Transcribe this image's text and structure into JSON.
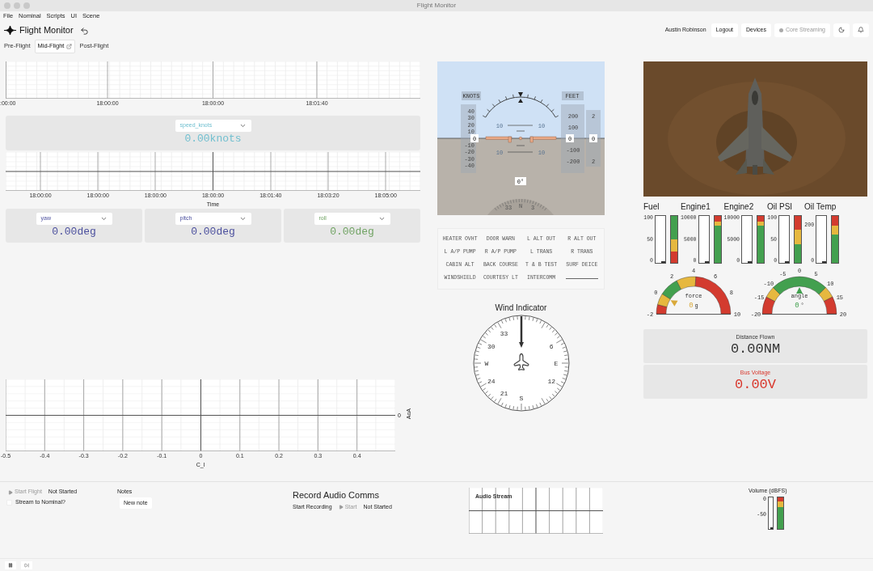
{
  "window": {
    "title": "Flight Monitor"
  },
  "menu": [
    "File",
    "Nominal",
    "Scripts",
    "UI",
    "Scene"
  ],
  "app": {
    "title": "Flight Monitor"
  },
  "user": {
    "name": "Austin Robinson"
  },
  "header_buttons": [
    {
      "label": "Logout"
    },
    {
      "label": "Devices"
    }
  ],
  "streaming": {
    "label": "Core Streaming",
    "disabled": true
  },
  "tabs": [
    {
      "label": "Pre-Flight",
      "selected": false,
      "popout": false
    },
    {
      "label": "Mid-Flight",
      "selected": true,
      "popout": true
    },
    {
      "label": "Post-Flight",
      "selected": false,
      "popout": false
    }
  ],
  "time_chart_top": {
    "x_tick_labels": [
      ":00:00",
      "18:00:00",
      "18:00:00",
      "18:01:40"
    ]
  },
  "speed_readout": {
    "channel": "speed_knots",
    "value": "0.00knots",
    "color": "#72c0d0"
  },
  "time_chart": {
    "x_tick_labels": [
      "18:00:00",
      "18:00:00",
      "18:00:00",
      "18:00:00",
      "18:01:40",
      "18:03:20",
      "18:05:00"
    ],
    "xlabel": "Time"
  },
  "readouts": [
    {
      "channel": "yaw",
      "value": "0.00deg",
      "color": "#4c509e"
    },
    {
      "channel": "pitch",
      "value": "0.00deg",
      "color": "#4c509e"
    },
    {
      "channel": "roll",
      "value": "0.00deg",
      "color": "#72a465"
    }
  ],
  "aoa_chart": {
    "x_tick_labels": [
      "-0.5",
      "-0.4",
      "-0.3",
      "-0.2",
      "-0.1",
      "0",
      "0.1",
      "0.2",
      "0.3",
      "0.4"
    ],
    "y_tick_labels": [
      "0"
    ],
    "xlabel": "C_l",
    "ylabel": "AoA"
  },
  "attitude": {
    "speed_title": "KNOTS",
    "speed_labels": [
      "40",
      "30",
      "20",
      "10",
      "-10",
      "-20",
      "-30",
      "-40"
    ],
    "speed_value": "0",
    "alt_title": "FEET",
    "alt_labels": [
      "200",
      "100",
      "-100",
      "-200"
    ],
    "alt_value": "0",
    "vs_labels": [
      "2",
      "2"
    ],
    "vs_value": "0",
    "pitch_labels": [
      "10",
      "10",
      "10",
      "10"
    ],
    "heading": "0°",
    "compass_labels": [
      "33",
      "N",
      "3"
    ]
  },
  "annunciators": [
    {
      "kind": "label",
      "text": "HEATER OVHT"
    },
    {
      "kind": "label",
      "text": "DOOR WARN"
    },
    {
      "kind": "label",
      "text": "L ALT OUT"
    },
    {
      "kind": "label",
      "text": "R ALT OUT"
    },
    {
      "kind": "label",
      "text": "L A/P PUMP"
    },
    {
      "kind": "label",
      "text": "R A/P PUMP"
    },
    {
      "kind": "label",
      "text": "L TRANS"
    },
    {
      "kind": "label",
      "text": "R TRANS"
    },
    {
      "kind": "label",
      "text": "CABIN ALT"
    },
    {
      "kind": "label",
      "text": "BACK COURSE"
    },
    {
      "kind": "label",
      "text": "T & B TEST"
    },
    {
      "kind": "label",
      "text": "SURF DEICE"
    },
    {
      "kind": "label",
      "text": "WINDSHIELD"
    },
    {
      "kind": "label",
      "text": "COURTESY LT"
    },
    {
      "kind": "label",
      "text": "INTERCOMM"
    },
    {
      "kind": "blank"
    }
  ],
  "wind": {
    "title": "Wind Indicator",
    "labels": [
      "33",
      "30",
      "W",
      "24",
      "21",
      "S",
      "12",
      "E",
      "6"
    ]
  },
  "bar_gauges": [
    {
      "label": "Fuel",
      "ticks": [
        "100",
        "50",
        "0"
      ],
      "level": 0,
      "zones": [
        {
          "color": "#d33b2f"
        },
        {
          "color": "#e6b83f"
        },
        {
          "color": "#43a04f"
        }
      ]
    },
    {
      "label": "Engine1",
      "ticks": [
        "10000",
        "5000",
        "0"
      ],
      "level": 0,
      "zones": [
        {
          "color": "#43a04f"
        },
        {
          "color": "#e6b83f"
        },
        {
          "color": "#d33b2f"
        }
      ]
    },
    {
      "label": "Engine2",
      "ticks": [
        "10000",
        "5000",
        "0"
      ],
      "level": 0,
      "zones": [
        {
          "color": "#43a04f"
        },
        {
          "color": "#e6b83f"
        },
        {
          "color": "#d33b2f"
        }
      ]
    },
    {
      "label": "Oil PSI",
      "ticks": [
        "100",
        "50",
        "0"
      ],
      "level": 0,
      "zones": [
        {
          "color": "#43a04f"
        },
        {
          "color": "#e6b83f"
        },
        {
          "color": "#d33b2f"
        }
      ]
    },
    {
      "label": "Oil Temp",
      "ticks": [
        "200",
        "0"
      ],
      "level": 0,
      "zones": [
        {
          "color": "#43a04f"
        },
        {
          "color": "#e6b83f"
        },
        {
          "color": "#d33b2f"
        }
      ]
    }
  ],
  "arc_gauges": [
    {
      "label": "force",
      "value": "0",
      "unit": "g",
      "color": "#d9a93a",
      "ticks": [
        "-2",
        "0",
        "2",
        "4",
        "6",
        "8",
        "10"
      ],
      "zones": [
        {
          "color": "#d33b2f"
        },
        {
          "color": "#e6b83f"
        },
        {
          "color": "#43a04f"
        },
        {
          "color": "#e6b83f"
        },
        {
          "color": "#d33b2f"
        }
      ]
    },
    {
      "label": "angle",
      "value": "0",
      "unit": "°",
      "color": "#43a04f",
      "ticks": [
        "-20",
        "-15",
        "-10",
        "-5",
        "0",
        "5",
        "10",
        "15",
        "20"
      ],
      "zones": [
        {
          "color": "#d33b2f"
        },
        {
          "color": "#e6b83f"
        },
        {
          "color": "#43a04f"
        },
        {
          "color": "#e6b83f"
        },
        {
          "color": "#d33b2f"
        }
      ]
    }
  ],
  "stat_cards": [
    {
      "label": "Distance Flown",
      "value": "0.00NM",
      "color": "#333333"
    },
    {
      "label": "Bus Voltage",
      "value": "0.00V",
      "color": "#d9382d"
    }
  ],
  "flight": {
    "button": "Start Flight",
    "disabled": true,
    "status": "Not Started",
    "stream_label": "Stream to Nominal?",
    "stream_checked": false
  },
  "notes": {
    "title": "Notes",
    "button": "New note"
  },
  "audio": {
    "title": "Record Audio Comms",
    "label": "Start Recording",
    "button": "Start",
    "disabled": true,
    "status": "Not Started",
    "stream_title": "Audio Stream"
  },
  "volume": {
    "title": "Volume (dBFS)",
    "ticks": [
      "0",
      "-50"
    ],
    "level": 0,
    "zones": [
      {
        "color": "#43a04f"
      },
      {
        "color": "#e6b83f"
      },
      {
        "color": "#d33b2f"
      }
    ]
  },
  "transport": {
    "playing": true
  }
}
